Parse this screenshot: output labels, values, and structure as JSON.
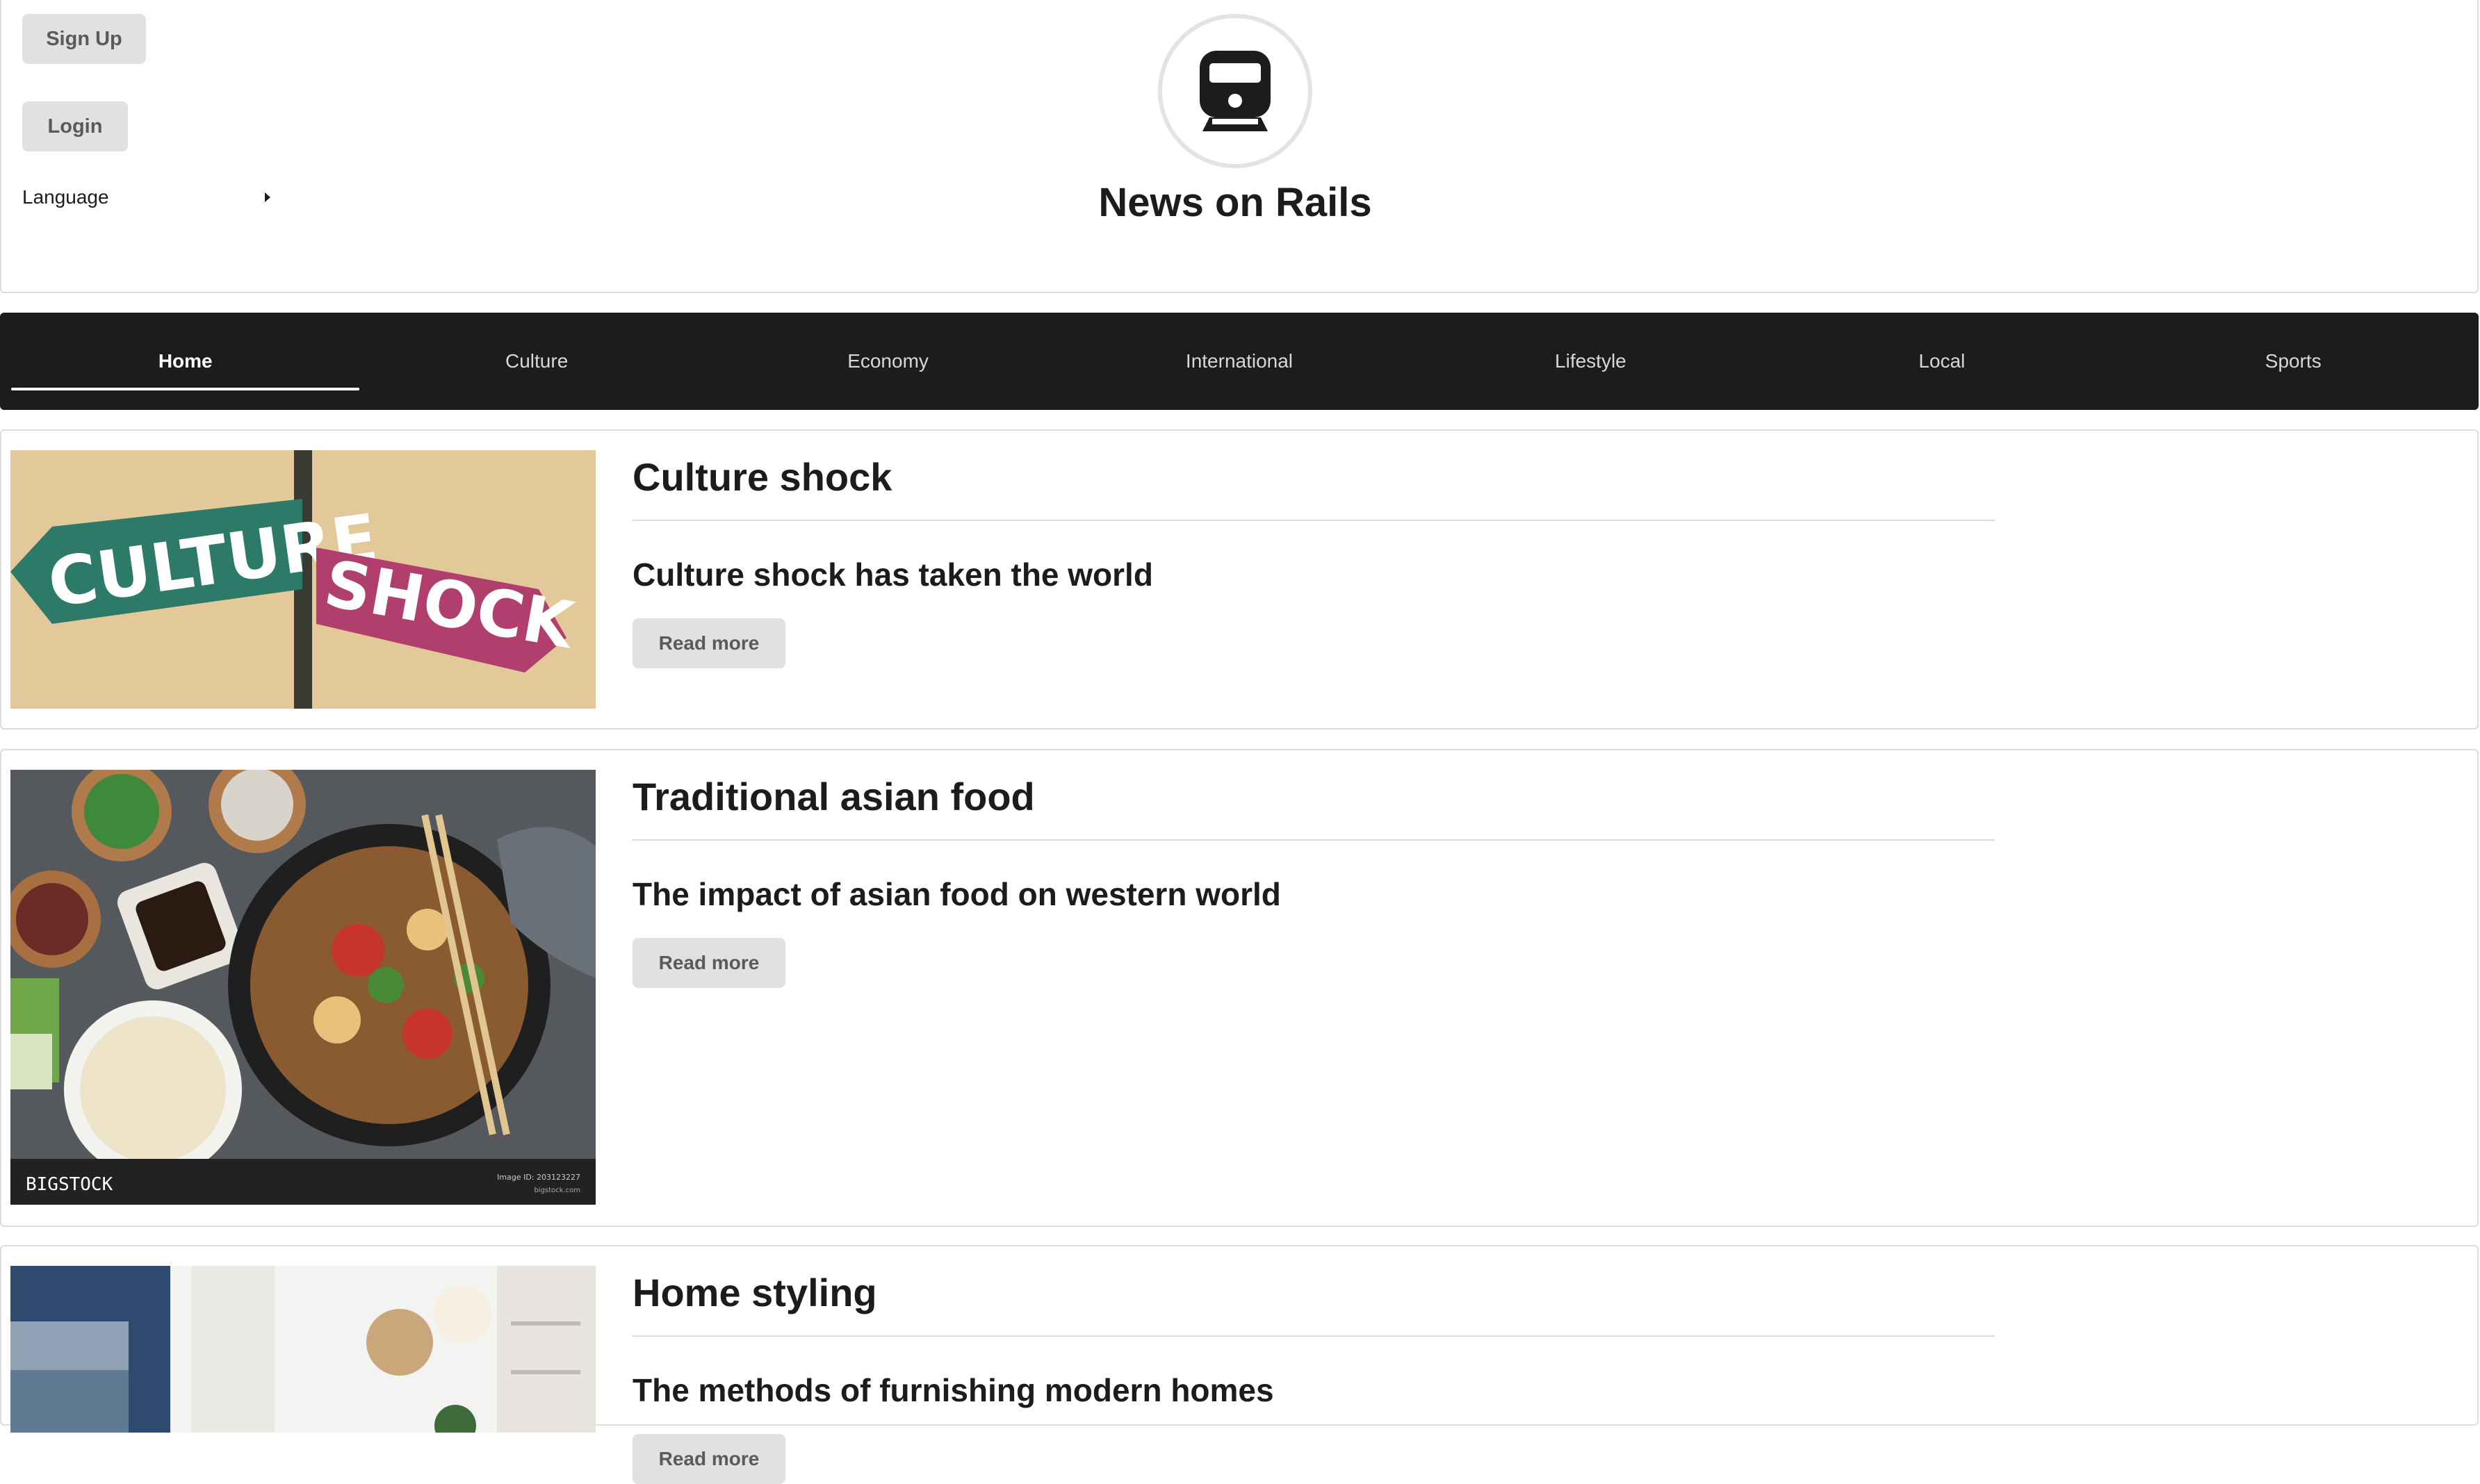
{
  "auth": {
    "signup_label": "Sign Up",
    "login_label": "Login",
    "language_label": "Language"
  },
  "site": {
    "title": "News on Rails",
    "logo_icon": "train-icon"
  },
  "nav": {
    "items": [
      {
        "label": "Home",
        "active": true
      },
      {
        "label": "Culture",
        "active": false
      },
      {
        "label": "Economy",
        "active": false
      },
      {
        "label": "International",
        "active": false
      },
      {
        "label": "Lifestyle",
        "active": false
      },
      {
        "label": "Local",
        "active": false
      },
      {
        "label": "Sports",
        "active": false
      }
    ]
  },
  "articles": [
    {
      "title": "Culture shock",
      "description": "Culture shock has taken the world",
      "read_more": "Read more",
      "image": {
        "sign_left": "CULTURE",
        "sign_right": "SHOCK"
      }
    },
    {
      "title": "Traditional asian food",
      "description": "The impact of asian food on western world",
      "read_more": "Read more",
      "image": {
        "watermark": "BIGSTOCK",
        "image_id": "Image ID: 203123227",
        "site": "bigstock.com"
      }
    },
    {
      "title": "Home styling",
      "description": "The methods of furnishing modern homes",
      "read_more": "Read more"
    }
  ],
  "colors": {
    "nav_bg": "#1b1c1d",
    "button_bg": "#e0e1e2",
    "border": "#dcdcdd"
  }
}
